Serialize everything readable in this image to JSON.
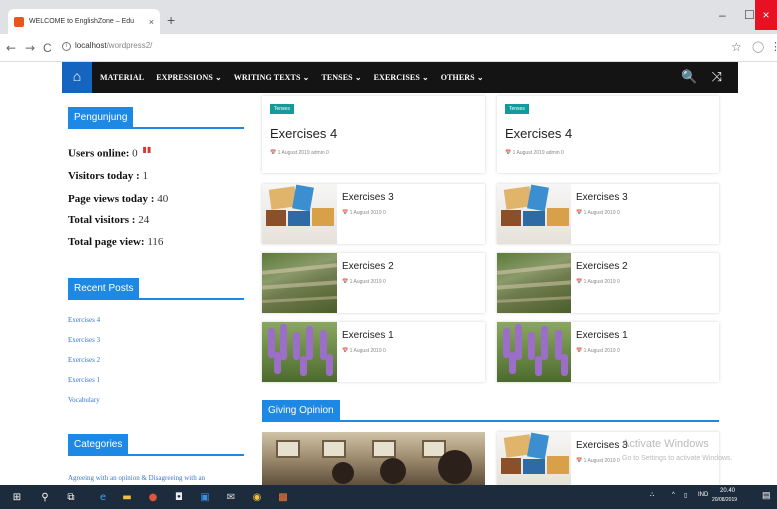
{
  "browser": {
    "tab_title": "WELCOME to EnglishZone – Edu",
    "tab_close": "×",
    "new_tab": "+",
    "minimize": "–",
    "maximize": "☐",
    "close": "×",
    "back": "←",
    "forward": "→",
    "reload": "C",
    "info": "i",
    "url_host": "localhost",
    "url_path": "/wordpress2/",
    "star": "☆",
    "extension": "◯",
    "menu": "⋮"
  },
  "navbar": {
    "home_icon": "⌂",
    "items": [
      {
        "label": "MATERIAL"
      },
      {
        "label": "EXPRESSIONS ⌄"
      },
      {
        "label": "WRITING TEXTS ⌄"
      },
      {
        "label": "TENSES ⌄"
      },
      {
        "label": "EXERCISES ⌄"
      },
      {
        "label": "OTHERS ⌄"
      }
    ],
    "search_icon": "🔍",
    "shuffle_icon": "⤨"
  },
  "sidebar": {
    "visitors_widget": {
      "title": "Pengunjung",
      "users_online_label": "Users online:",
      "users_online_value": "0",
      "visitors_today_label": "Visitors today :",
      "visitors_today_value": "1",
      "page_views_today_label": "Page views today :",
      "page_views_today_value": "40",
      "total_visitors_label": "Total visitors :",
      "total_visitors_value": "24",
      "total_page_view_label": "Total page view:",
      "total_page_view_value": "116"
    },
    "recent_posts": {
      "title": "Recent Posts",
      "items": [
        "Exercises 4",
        "Exercises 3",
        "Exercises 2",
        "Exercises 1",
        "Vocabulary"
      ]
    },
    "categories": {
      "title": "Categories",
      "first_item": "Agreeing with an opinion & Disagreeing with an"
    }
  },
  "main": {
    "featured": [
      {
        "badge": "Tenses",
        "title": "Exercises 4",
        "meta": "1 August 2019   admin   0"
      },
      {
        "badge": "Tenses",
        "title": "Exercises 4",
        "meta": "1 August 2019   admin   0"
      }
    ],
    "posts": [
      {
        "title": "Exercises 3",
        "meta": "1 August 2019   0"
      },
      {
        "title": "Exercises 3",
        "meta": "1 August 2019   0"
      },
      {
        "title": "Exercises 2",
        "meta": "1 August 2019   0"
      },
      {
        "title": "Exercises 2",
        "meta": "1 August 2019   0"
      },
      {
        "title": "Exercises 1",
        "meta": "1 August 2019   0"
      },
      {
        "title": "Exercises 1",
        "meta": "1 August 2019   0"
      }
    ],
    "section_title": "Giving Opinion",
    "opinion_post": {
      "title": "Exercises 3",
      "meta": "1 August 2019   0"
    }
  },
  "watermark": {
    "line1": "Activate Windows",
    "line2": "Go to Settings to activate Windows."
  },
  "taskbar": {
    "start": "⊞",
    "search": "⚲",
    "lang": "IND",
    "time": "20.40",
    "date": "20/08/2019"
  },
  "colors": {
    "accent": "#1e88e5",
    "badge": "#159a9c",
    "navbar": "#141414",
    "home": "#1565c0"
  }
}
